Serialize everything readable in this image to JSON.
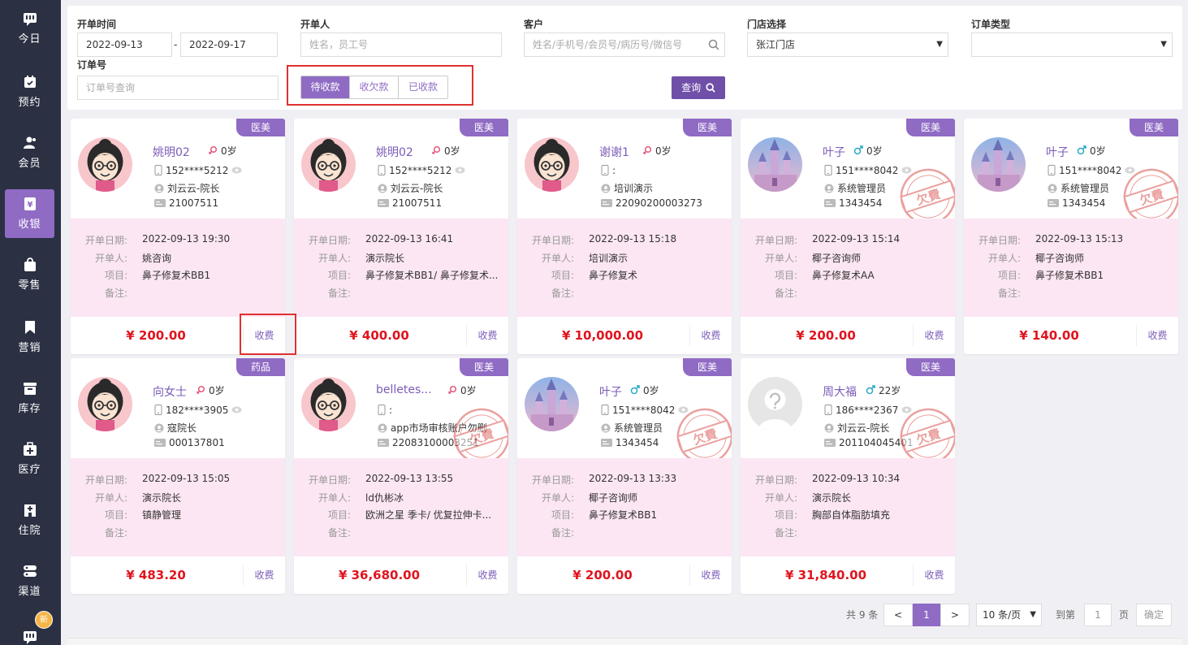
{
  "colors": {
    "accent": "#8f6bc4",
    "sidebar": "#2b3143",
    "price": "#e0141e",
    "detail_bg": "#fce6f3"
  },
  "sidebar": {
    "items": [
      {
        "label": "今日",
        "icon": "chat-icon"
      },
      {
        "label": "预约",
        "icon": "calendar-icon"
      },
      {
        "label": "会员",
        "icon": "members-icon"
      },
      {
        "label": "收银",
        "icon": "yen-icon",
        "active": true
      },
      {
        "label": "零售",
        "icon": "bag-icon"
      },
      {
        "label": "营销",
        "icon": "bookmark-icon"
      },
      {
        "label": "库存",
        "icon": "inbox-icon"
      },
      {
        "label": "医疗",
        "icon": "medical-box-icon"
      },
      {
        "label": "住院",
        "icon": "hospital-icon"
      },
      {
        "label": "渠道",
        "icon": "channel-icon"
      },
      {
        "label": "",
        "icon": "chat-icon",
        "badge": "新"
      }
    ]
  },
  "filter": {
    "open_time_label": "开单时间",
    "date_from": "2022-09-13",
    "date_sep": "-",
    "date_to": "2022-09-17",
    "opener_label": "开单人",
    "opener_placeholder": "姓名，员工号",
    "customer_label": "客户",
    "customer_placeholder": "姓名/手机号/会员号/病历号/微信号",
    "store_label": "门店选择",
    "store_value": "张江门店",
    "order_type_label": "订单类型",
    "order_type_value": "",
    "order_no_label": "订单号",
    "order_no_placeholder": "订单号查询",
    "status_tabs": [
      {
        "label": "待收款",
        "active": true
      },
      {
        "label": "收欠款"
      },
      {
        "label": "已收款"
      }
    ],
    "query_label": "查询"
  },
  "detail_labels": {
    "date": "开单日期:",
    "opener": "开单人:",
    "item": "项目:",
    "remark": "备注:"
  },
  "pay_label": "收费",
  "orders": [
    {
      "tag": "医美",
      "name": "姚明02",
      "gender": "female",
      "age": "0岁",
      "phone": "152****5212",
      "consultant": "刘云云-院长",
      "member_no": "21007511",
      "date": "2022-09-13 19:30",
      "opener": "姚咨询",
      "item": "鼻子修复术BB1",
      "remark": "",
      "price": "¥ 200.00",
      "avatar": "cartoon",
      "owed": false
    },
    {
      "tag": "医美",
      "name": "姚明02",
      "gender": "female",
      "age": "0岁",
      "phone": "152****5212",
      "consultant": "刘云云-院长",
      "member_no": "21007511",
      "date": "2022-09-13 16:41",
      "opener": "演示院长",
      "item": "鼻子修复术BB1/ 鼻子修复术...",
      "remark": "",
      "price": "¥ 400.00",
      "avatar": "cartoon",
      "owed": false
    },
    {
      "tag": "医美",
      "name": "谢谢1",
      "gender": "female",
      "age": "0岁",
      "phone": ":",
      "consultant": "培训演示",
      "member_no": "22090200003273",
      "date": "2022-09-13 15:18",
      "opener": "培训演示",
      "item": "鼻子修复术",
      "remark": "",
      "price": "¥ 10,000.00",
      "avatar": "cartoon",
      "owed": false
    },
    {
      "tag": "医美",
      "name": "叶子",
      "gender": "male",
      "age": "0岁",
      "phone": "151****8042",
      "consultant": "系统管理员",
      "member_no": "1343454",
      "date": "2022-09-13 15:14",
      "opener": "椰子咨询师",
      "item": "鼻子修复术AA",
      "remark": "",
      "price": "¥ 200.00",
      "avatar": "castle",
      "owed": true
    },
    {
      "tag": "医美",
      "name": "叶子",
      "gender": "male",
      "age": "0岁",
      "phone": "151****8042",
      "consultant": "系统管理员",
      "member_no": "1343454",
      "date": "2022-09-13 15:13",
      "opener": "椰子咨询师",
      "item": "鼻子修复术BB1",
      "remark": "",
      "price": "¥ 140.00",
      "avatar": "castle",
      "owed": true
    },
    {
      "tag": "药品",
      "name": "向女士",
      "gender": "female",
      "age": "0岁",
      "phone": "182****3905",
      "consultant": "寇院长",
      "member_no": "000137801",
      "date": "2022-09-13 15:05",
      "opener": "演示院长",
      "item": "镇静管理",
      "remark": "",
      "price": "¥ 483.20",
      "avatar": "cartoon",
      "owed": false
    },
    {
      "tag": "医美",
      "name": "belletes...",
      "gender": "female",
      "age": "0岁",
      "phone": ":",
      "consultant": "app市场审核账户勿删",
      "member_no": "22083100003251",
      "date": "2022-09-13 13:55",
      "opener": "ld仇彬冰",
      "item": "欧洲之星 季卡/ 优复拉伸卡...",
      "remark": "",
      "price": "¥ 36,680.00",
      "avatar": "cartoon",
      "owed": true
    },
    {
      "tag": "医美",
      "name": "叶子",
      "gender": "male",
      "age": "0岁",
      "phone": "151****8042",
      "consultant": "系统管理员",
      "member_no": "1343454",
      "date": "2022-09-13 13:33",
      "opener": "椰子咨询师",
      "item": "鼻子修复术BB1",
      "remark": "",
      "price": "¥ 200.00",
      "avatar": "castle",
      "owed": true
    },
    {
      "tag": "医美",
      "name": "周大福",
      "gender": "male",
      "age": "22岁",
      "phone": "186****2367",
      "consultant": "刘云云-院长",
      "member_no": "201104045401",
      "date": "2022-09-13 10:34",
      "opener": "演示院长",
      "item": "胸部自体脂肪填充",
      "remark": "",
      "price": "¥ 31,840.00",
      "avatar": "default",
      "owed": true
    }
  ],
  "stamp_text": "欠費",
  "pagination": {
    "total": "共 9 条",
    "prev": "<",
    "current": "1",
    "next": ">",
    "page_size": "10 条/页",
    "goto_label": "到第",
    "goto_value": "1",
    "page_unit": "页",
    "confirm": "确定"
  }
}
